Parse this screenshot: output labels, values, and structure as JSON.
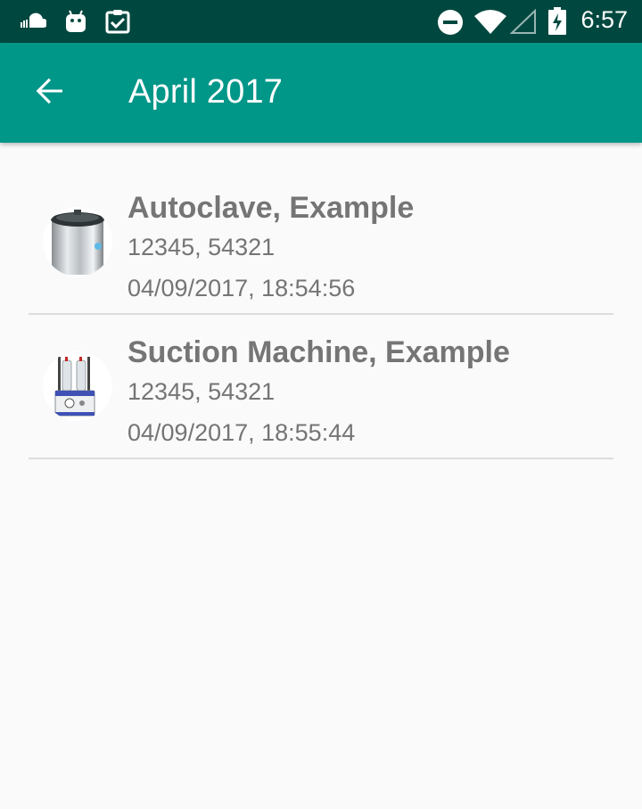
{
  "status_bar": {
    "time": "6:57",
    "icons": [
      "cloud-icon",
      "android-icon",
      "clipboard-check-icon",
      "do-not-disturb-icon",
      "wifi-icon",
      "cell-signal-icon",
      "battery-charging-icon"
    ]
  },
  "app_bar": {
    "title": "April 2017",
    "back_icon": "arrow-back-icon",
    "color": "#009688"
  },
  "items": [
    {
      "title": "Autoclave, Example",
      "numbers": "12345, 54321",
      "datetime": "04/09/2017, 18:54:56",
      "image": "autoclave-image"
    },
    {
      "title": "Suction Machine, Example",
      "numbers": "12345, 54321",
      "datetime": "04/09/2017, 18:55:44",
      "image": "suction-machine-image"
    }
  ]
}
